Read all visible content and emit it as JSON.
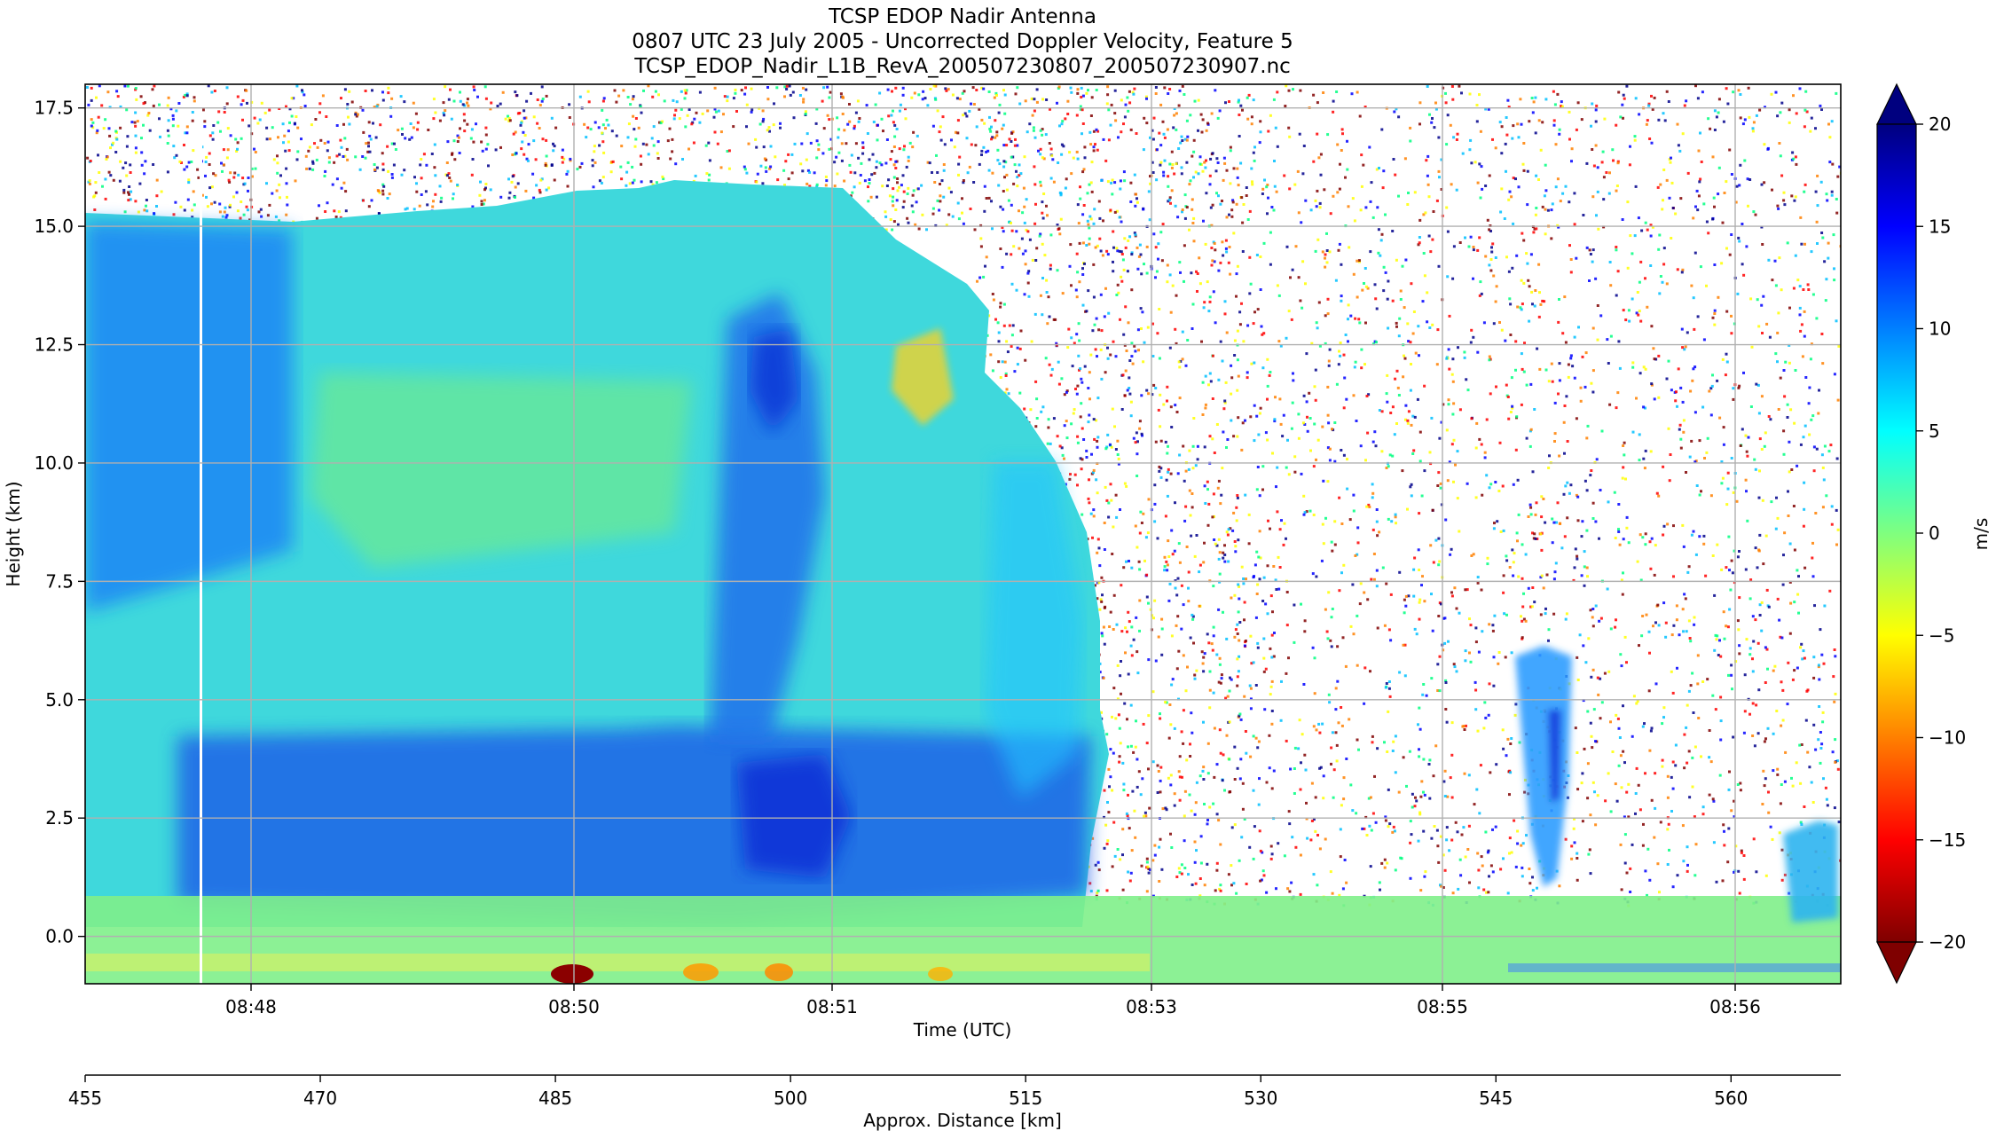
{
  "chart_data": {
    "type": "heatmap",
    "title_lines": [
      "TCSP EDOP Nadir Antenna",
      "0807 UTC 23 July 2005 - Uncorrected Doppler Velocity, Feature 5",
      "TCSP_EDOP_Nadir_L1B_RevA_200507230807_200507230907.nc"
    ],
    "xlabel": "Time (UTC)",
    "ylabel": "Height (km)",
    "x_ticks": [
      "08:48",
      "08:50",
      "08:51",
      "08:53",
      "08:55",
      "08:56"
    ],
    "y_ticks": [
      "0.0",
      "2.5",
      "5.0",
      "7.5",
      "10.0",
      "12.5",
      "15.0",
      "17.5"
    ],
    "y_tick_values": [
      0,
      2.5,
      5,
      7.5,
      10,
      12.5,
      15,
      17.5
    ],
    "ylim": [
      -1.0,
      18.0
    ],
    "grid": true,
    "secondary_axis": {
      "label": "Approx. Distance [km]",
      "ticks": [
        "455",
        "470",
        "485",
        "500",
        "515",
        "530",
        "545",
        "560"
      ],
      "tick_values": [
        455,
        470,
        485,
        500,
        515,
        530,
        545,
        560
      ],
      "range": [
        455,
        567
      ]
    },
    "colorbar": {
      "label": "m/s",
      "ticks": [
        "20",
        "15",
        "10",
        "5",
        "0",
        "−10",
        "−15",
        "−20"
      ],
      "tick_values": [
        20,
        15,
        10,
        5,
        0,
        -10,
        -15,
        -20
      ],
      "extra_tick": "−5",
      "extra_tick_value": -5,
      "range": [
        -20,
        20
      ],
      "extend": "both",
      "colormap": "jet reversed (positive = blue, negative = red)"
    },
    "field_description": "Doppler velocity curtain; dense echo from ~08:47 to ~08:52:40 reaching ~15-16 km, strongest positive (blue) velocities 1-4 km and near 08:50:40; noise elsewhere; small cells near 08:55:30 and 08:56:30"
  },
  "colors": {
    "grid": "#b0b0b0",
    "noise_palette": [
      "#00bfff",
      "#ff0000",
      "#ffff00",
      "#0000ff",
      "#00ff80",
      "#ff8000",
      "#800000",
      "#00008b"
    ]
  }
}
